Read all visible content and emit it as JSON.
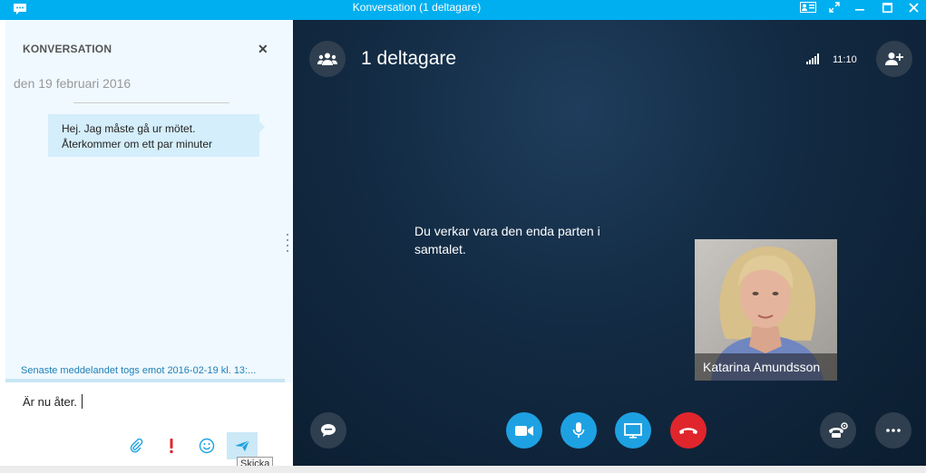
{
  "window": {
    "title": "Konversation (1 deltagare)"
  },
  "conversation": {
    "header": "KONVERSATION",
    "date": "den 19 februari 2016",
    "messages": [
      {
        "line1": "Hej. Jag måste gå ur mötet.",
        "line2": "Återkommer om ett par minuter"
      }
    ],
    "last_received": "Senaste meddelandet togs emot 2016-02-19 kl. 13:...",
    "compose_text": "Är nu åter.",
    "send_tooltip": "Skicka"
  },
  "call": {
    "participants_label": "1 deltagare",
    "timer": "11:10",
    "only_party_message": "Du verkar vara den enda parten i samtalet.",
    "participant_name": "Katarina Amundsson"
  },
  "colors": {
    "titlebar": "#00aff0",
    "accent_blue": "#1ea1e2",
    "hangup_red": "#e0262c",
    "stage_dark": "#0f2438"
  }
}
